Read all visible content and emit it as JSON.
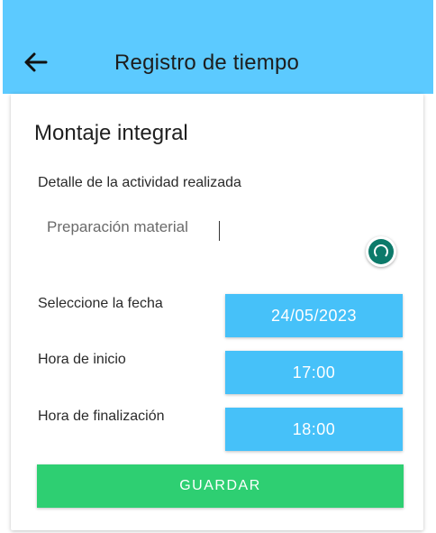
{
  "header": {
    "title": "Registro de tiempo",
    "back_icon": "arrow-left-icon",
    "background": "#5ccaff"
  },
  "form": {
    "title": "Montaje integral",
    "detail_label": "Detalle de la actividad realizada",
    "detail_value": "Preparación material",
    "date_label": "Seleccione la fecha",
    "date_value": "24/05/2023",
    "start_label": "Hora de inicio",
    "start_value": "17:00",
    "end_label": "Hora de finalización",
    "end_value": "18:00",
    "save_label": "GUARDAR"
  },
  "colors": {
    "field_button": "#46c1f9",
    "save_button": "#2ecf72",
    "selection_handle": "#0c7a6a"
  }
}
